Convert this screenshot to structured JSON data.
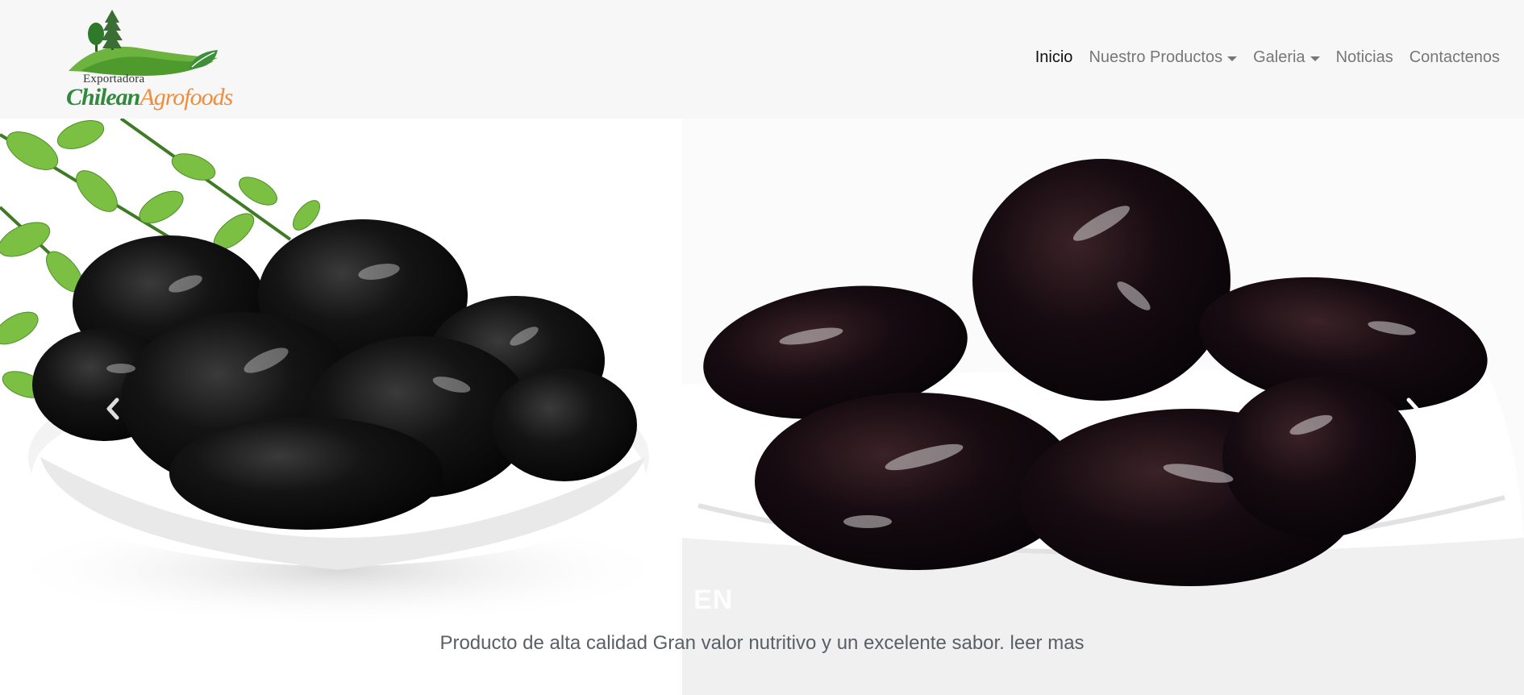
{
  "header": {
    "logo": {
      "line1": "Exportadora",
      "brand_part1": "Chilean",
      "brand_part2": "Agrofoods"
    },
    "nav": [
      {
        "label": "Inicio",
        "active": true
      },
      {
        "label": "Nuestro Productos",
        "dropdown": true
      },
      {
        "label": "Galeria",
        "dropdown": true
      },
      {
        "label": "Noticias"
      },
      {
        "label": "Contactenos"
      }
    ]
  },
  "carousel": {
    "slide_title": "EN",
    "caption": "Producto de alta calidad Gran valor nutritivo y un excelente sabor. leer mas",
    "prev_icon": "chevron-left-icon",
    "next_icon": "chevron-right-icon"
  },
  "colors": {
    "header_bg": "#f7f7f7",
    "nav_text": "#777777",
    "nav_active": "#111111",
    "brand_green": "#2f8a3b",
    "brand_orange": "#f08c3a"
  }
}
